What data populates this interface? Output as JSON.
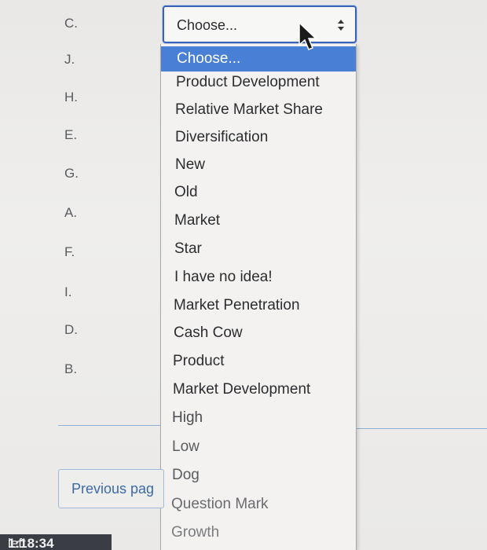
{
  "question": {
    "letters": [
      "C.",
      "J.",
      "H.",
      "E.",
      "G.",
      "A.",
      "F.",
      "I.",
      "D.",
      "B."
    ]
  },
  "select": {
    "value": "Choose...",
    "icon": "updown-arrows-icon"
  },
  "dropdown": {
    "selected_index": 0,
    "options": [
      "Choose...",
      "Product Development",
      "Relative Market Share",
      "Diversification",
      "New",
      "Old",
      "Market",
      "Star",
      "I have no idea!",
      "Market Penetration",
      "Cash Cow",
      "Product",
      "Market Development",
      "High",
      "Low",
      "Dog",
      "Question Mark",
      "Growth"
    ]
  },
  "navigation": {
    "previous_label": "Previous pag"
  },
  "timer": {
    "label": "left",
    "value": "1:18:34"
  },
  "colors": {
    "select_border": "#3b63b5",
    "highlight": "#4a7fd6",
    "link": "#3d6aa6"
  }
}
